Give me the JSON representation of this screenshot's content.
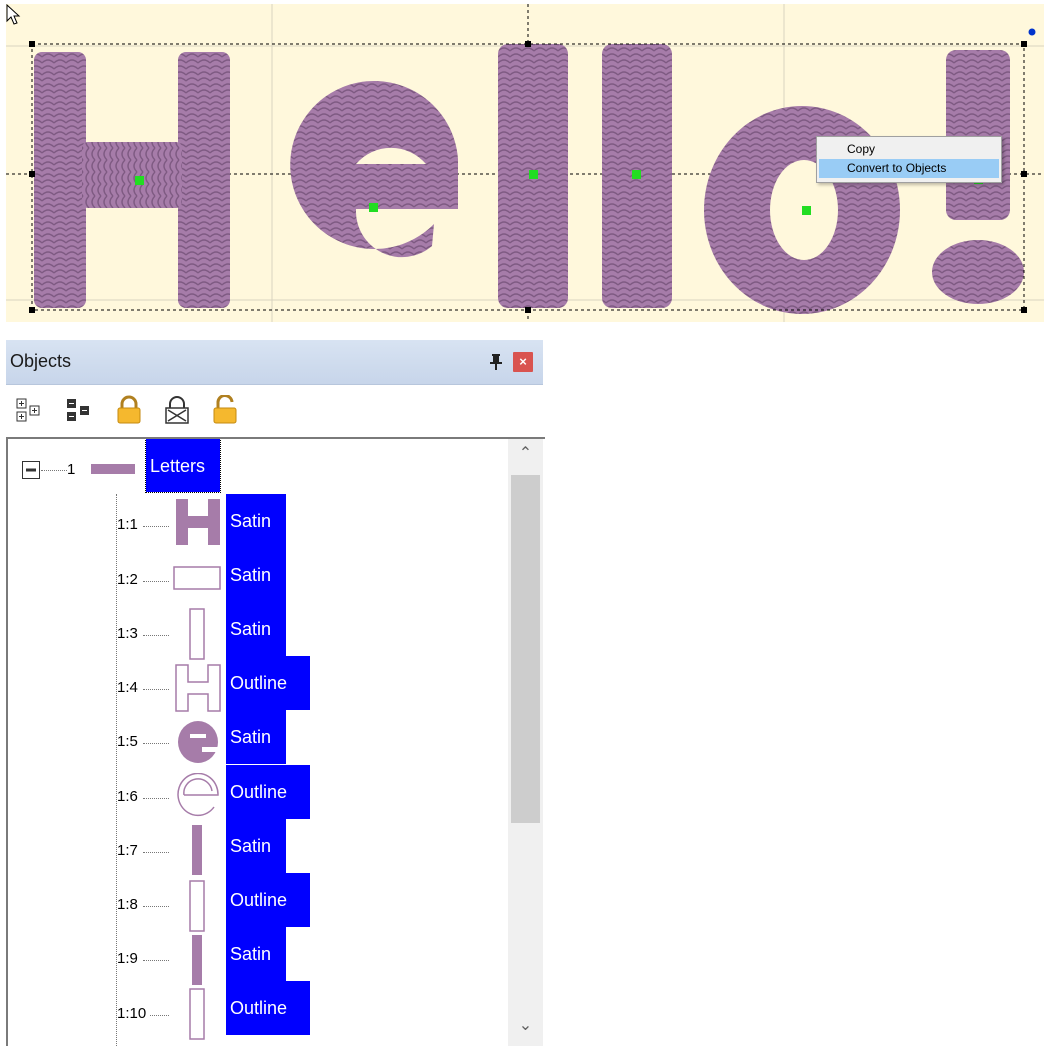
{
  "context_menu": {
    "items": [
      {
        "label": "Copy",
        "highlighted": false
      },
      {
        "label": "Convert to Objects",
        "highlighted": true
      }
    ]
  },
  "canvas": {
    "background": "#fff8dc",
    "thread_color": "#a67ca9",
    "text": "Hello!"
  },
  "objects_panel": {
    "title": "Objects",
    "toolbar": [
      "expand-all-icon",
      "collapse-all-icon",
      "lock-icon",
      "lock-disabled-icon",
      "unlock-icon"
    ],
    "tree": {
      "root": {
        "number": "1",
        "label": "Letters",
        "expanded_symbol": "−"
      },
      "children": [
        {
          "number": "1:1",
          "type": "Satin",
          "thumb": "H-satin"
        },
        {
          "number": "1:2",
          "type": "Satin",
          "thumb": "rect-outline"
        },
        {
          "number": "1:3",
          "type": "Satin",
          "thumb": "bar-outline"
        },
        {
          "number": "1:4",
          "type": "Outline",
          "thumb": "H-outline"
        },
        {
          "number": "1:5",
          "type": "Satin",
          "thumb": "e-satin"
        },
        {
          "number": "1:6",
          "type": "Outline",
          "thumb": "e-outline"
        },
        {
          "number": "1:7",
          "type": "Satin",
          "thumb": "l-satin"
        },
        {
          "number": "1:8",
          "type": "Outline",
          "thumb": "l-outline"
        },
        {
          "number": "1:9",
          "type": "Satin",
          "thumb": "l-satin"
        },
        {
          "number": "1:10",
          "type": "Outline",
          "thumb": "l-outline"
        }
      ]
    }
  }
}
